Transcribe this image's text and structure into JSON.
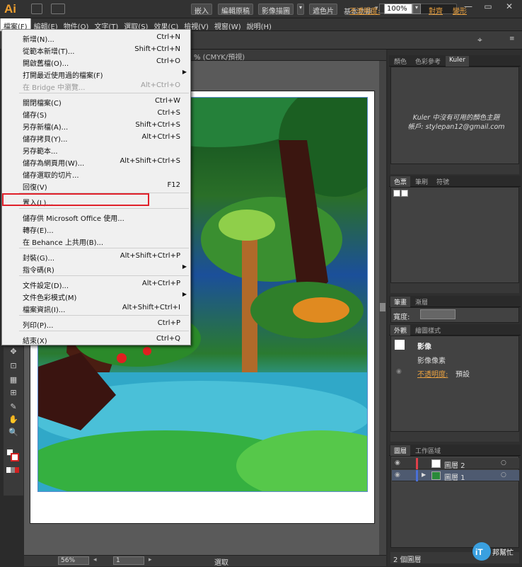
{
  "app": {
    "logo": "Ai",
    "workspace": "基本功能",
    "window_controls": [
      "—",
      "▭",
      "✕"
    ]
  },
  "menubar": [
    {
      "label": "檔案(F)",
      "active": true
    },
    {
      "label": "編輯(E)"
    },
    {
      "label": "物件(O)"
    },
    {
      "label": "文字(T)"
    },
    {
      "label": "選取(S)"
    },
    {
      "label": "效果(C)"
    },
    {
      "label": "檢視(V)"
    },
    {
      "label": "視窗(W)"
    },
    {
      "label": "說明(H)"
    }
  ],
  "controlbar": {
    "embed": "嵌入",
    "edit_original": "編輯原稿",
    "image_trace": "影像描圖",
    "mask": "遮色片",
    "opacity_label": "不透明度:",
    "opacity_value": "100%",
    "align": "對齊",
    "transform": "變形"
  },
  "document_tab": "% (CMYK/預視)",
  "file_menu": {
    "groups": [
      [
        {
          "label": "新增(N)...",
          "shortcut": "Ctrl+N"
        },
        {
          "label": "從範本新增(T)...",
          "shortcut": "Shift+Ctrl+N"
        },
        {
          "label": "開啟舊檔(O)...",
          "shortcut": "Ctrl+O"
        },
        {
          "label": "打開最近使用過的檔案(F)",
          "submenu": true
        },
        {
          "label": "在 Bridge 中瀏覽...",
          "shortcut": "Alt+Ctrl+O",
          "disabled": true
        }
      ],
      [
        {
          "label": "關閉檔案(C)",
          "shortcut": "Ctrl+W"
        },
        {
          "label": "儲存(S)",
          "shortcut": "Ctrl+S"
        },
        {
          "label": "另存新檔(A)...",
          "shortcut": "Shift+Ctrl+S"
        },
        {
          "label": "儲存拷貝(Y)...",
          "shortcut": "Alt+Ctrl+S"
        },
        {
          "label": "另存範本..."
        },
        {
          "label": "儲存為網頁用(W)...",
          "shortcut": "Alt+Shift+Ctrl+S"
        },
        {
          "label": "儲存選取的切片..."
        },
        {
          "label": "回復(V)",
          "shortcut": "F12"
        }
      ],
      [
        {
          "label": "置入(L)...",
          "highlighted": true
        }
      ],
      [
        {
          "label": "儲存供 Microsoft Office 使用..."
        },
        {
          "label": "轉存(E)..."
        },
        {
          "label": "在 Behance 上共用(B)..."
        }
      ],
      [
        {
          "label": "封裝(G)...",
          "shortcut": "Alt+Shift+Ctrl+P"
        },
        {
          "label": "指令碼(R)",
          "submenu": true
        }
      ],
      [
        {
          "label": "文件設定(D)...",
          "shortcut": "Alt+Ctrl+P"
        },
        {
          "label": "文件色彩模式(M)",
          "submenu": true
        },
        {
          "label": "檔案資訊(I)...",
          "shortcut": "Alt+Shift+Ctrl+I"
        }
      ],
      [
        {
          "label": "列印(P)...",
          "shortcut": "Ctrl+P"
        }
      ],
      [
        {
          "label": "結束(X)",
          "shortcut": "Ctrl+Q"
        }
      ]
    ]
  },
  "panels": {
    "color_tabs": [
      "顏色",
      "色彩參考",
      "Kuler"
    ],
    "kuler_message": "Kuler 中沒有可用的顏色主題",
    "kuler_account": "帳戶: stylepan12@gmail.com",
    "swatch_tabs": [
      "色票",
      "筆刷",
      "符號"
    ],
    "stroke_tabs": [
      "筆畫",
      "漸層"
    ],
    "stroke_width_label": "寬度:",
    "appearance_tabs": [
      "外觀",
      "繪圖樣式"
    ],
    "appearance_title": "影像",
    "appearance_item": "影像像素",
    "appearance_opacity_label": "不透明度:",
    "appearance_opacity_value": "預設",
    "layers_tabs": [
      "圖層",
      "工作區域"
    ],
    "layers": [
      {
        "name": "圖層 2",
        "color": "#e0404a",
        "selected": false
      },
      {
        "name": "圖層 1",
        "color": "#4a70d8",
        "selected": true
      }
    ],
    "layers_count": "2 個圖層"
  },
  "status": {
    "zoom": "56%",
    "page": "1",
    "tool": "選取"
  },
  "tools": [
    "✥",
    "⊡",
    "▦",
    "⊞",
    "✎",
    "✋",
    "🔍",
    "?"
  ],
  "watermark": "iT邦幫忙"
}
